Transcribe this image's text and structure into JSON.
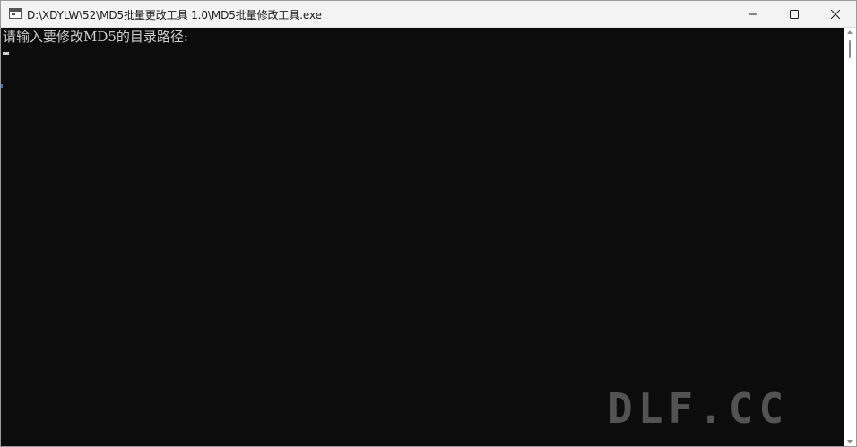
{
  "window": {
    "title": "D:\\XDYLW\\52\\MD5批量更改工具 1.0\\MD5批量修改工具.exe",
    "app_icon": "console-window-icon",
    "controls": {
      "minimize_icon": "minimize-icon",
      "maximize_icon": "maximize-icon",
      "close_icon": "close-icon"
    }
  },
  "console": {
    "prompt": "请输入要修改MD5的目录路径:",
    "background_color": "#0c0c0c",
    "text_color": "#cccccc"
  },
  "watermark": {
    "text": "DLF.CC"
  }
}
